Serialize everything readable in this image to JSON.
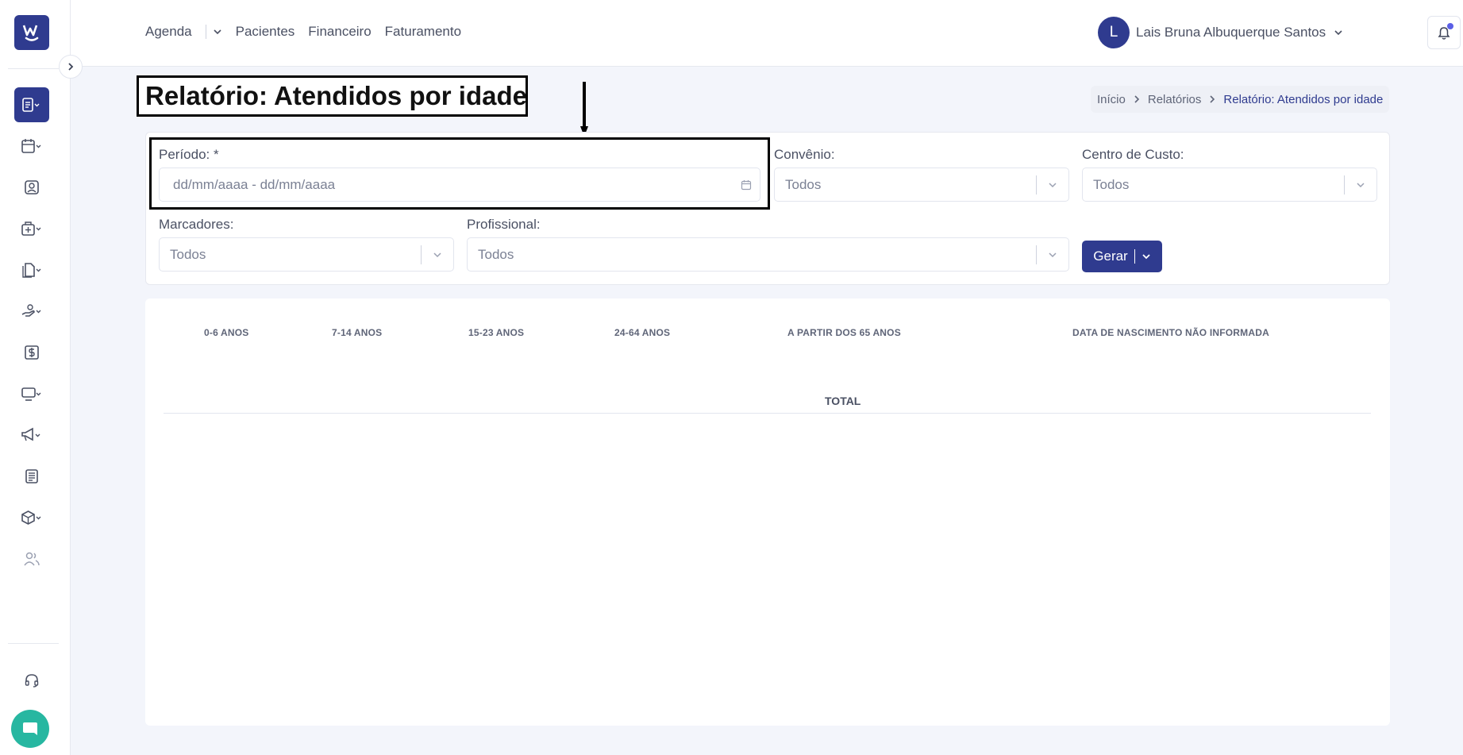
{
  "app": {
    "logo_icon": "w-smile-logo",
    "brand_color": "#2f3b8f"
  },
  "sidebar": {
    "items": [
      {
        "icon": "reports-icon",
        "active": true
      },
      {
        "icon": "calendar-icon"
      },
      {
        "icon": "patient-icon"
      },
      {
        "icon": "clinic-icon"
      },
      {
        "icon": "documents-icon"
      },
      {
        "icon": "hand-money-icon"
      },
      {
        "icon": "dollar-icon"
      },
      {
        "icon": "monitor-icon"
      },
      {
        "icon": "megaphone-icon"
      },
      {
        "icon": "newspaper-icon"
      },
      {
        "icon": "box-icon"
      },
      {
        "icon": "users-icon"
      }
    ],
    "support_icon": "headset-icon",
    "chat_icon": "chat-icon"
  },
  "topnav": {
    "agenda": "Agenda",
    "pacientes": "Pacientes",
    "financeiro": "Financeiro",
    "faturamento": "Faturamento"
  },
  "user": {
    "initial": "L",
    "name": "Lais Bruna Albuquerque Santos"
  },
  "page": {
    "title": "Relatório: Atendidos por idade"
  },
  "breadcrumb": {
    "home": "Início",
    "reports": "Relatórios",
    "current": "Relatório: Atendidos por idade"
  },
  "filters": {
    "periodo_label": "Período: *",
    "periodo_placeholder": "dd/mm/aaaa - dd/mm/aaaa",
    "convenio_label": "Convênio:",
    "convenio_value": "Todos",
    "centro_label": "Centro de Custo:",
    "centro_value": "Todos",
    "marcadores_label": "Marcadores:",
    "marcadores_value": "Todos",
    "profissional_label": "Profissional:",
    "profissional_value": "Todos",
    "gerar_label": "Gerar"
  },
  "results": {
    "columns": [
      "0-6 ANOS",
      "7-14 ANOS",
      "15-23 ANOS",
      "24-64 ANOS",
      "A PARTIR DOS 65 ANOS",
      "DATA DE NASCIMENTO NÃO INFORMADA"
    ],
    "total_label": "TOTAL"
  }
}
